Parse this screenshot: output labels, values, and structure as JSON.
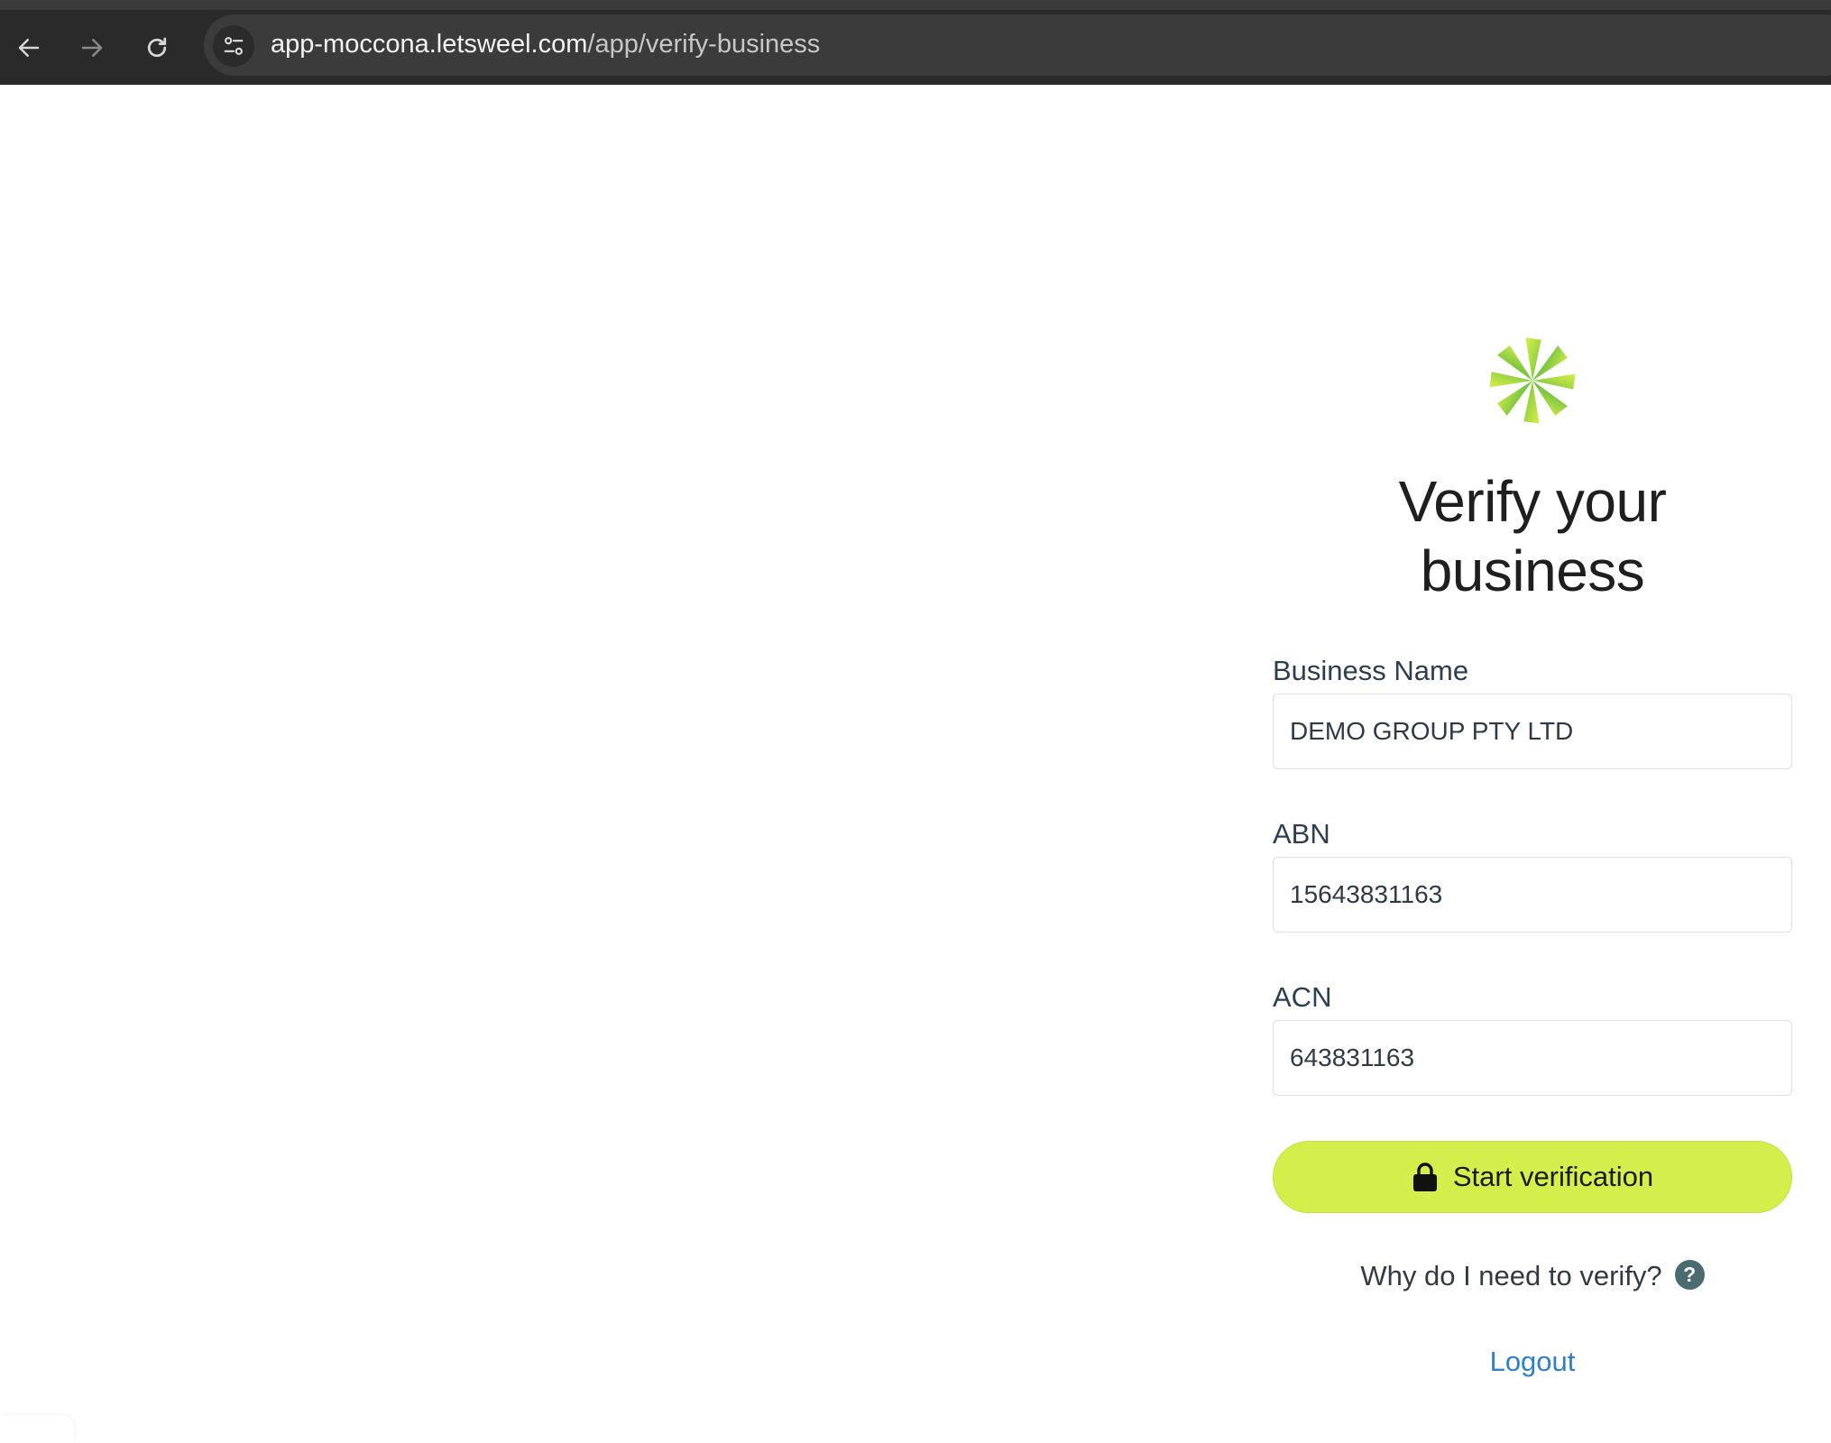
{
  "browser": {
    "url_host": "app-moccona.letsweel.com",
    "url_path": "/app/verify-business"
  },
  "form": {
    "title_line1": "Verify your",
    "title_line2": "business",
    "business_name_label": "Business Name",
    "business_name_value": "DEMO GROUP PTY LTD",
    "abn_label": "ABN",
    "abn_value": "15643831163",
    "acn_label": "ACN",
    "acn_value": "643831163",
    "submit_label": "Start verification",
    "why_text": "Why do I need to verify?",
    "help_glyph": "?",
    "logout_label": "Logout"
  },
  "icons": {
    "back": "back-arrow-icon",
    "forward": "forward-arrow-icon",
    "reload": "reload-icon",
    "site_settings": "tune-icon",
    "logo": "asterisk-logo-icon",
    "lock": "lock-icon",
    "help": "help-circle-icon"
  },
  "colors": {
    "accent": "#d4ee4c",
    "link": "#2f7fc9",
    "help_badge": "#4a6b6f",
    "browser_chrome": "#2a2a2a"
  }
}
